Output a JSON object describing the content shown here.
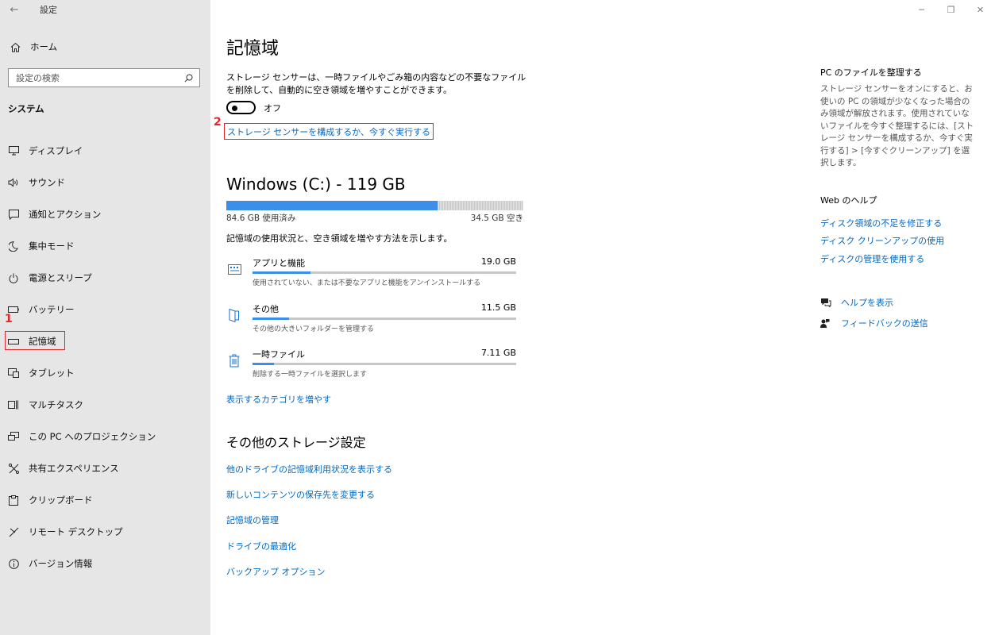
{
  "titlebar": {
    "back_icon": "back-arrow-icon",
    "title": "設定"
  },
  "window_controls": {
    "minimize": "─",
    "restore": "❐",
    "close": "✕"
  },
  "sidebar": {
    "home_label": "ホーム",
    "search_placeholder": "設定の検索",
    "section": "システム",
    "items": [
      {
        "label": "ディスプレイ",
        "icon": "display-icon"
      },
      {
        "label": "サウンド",
        "icon": "speaker-icon"
      },
      {
        "label": "通知とアクション",
        "icon": "notification-icon"
      },
      {
        "label": "集中モード",
        "icon": "moon-icon"
      },
      {
        "label": "電源とスリープ",
        "icon": "power-icon"
      },
      {
        "label": "バッテリー",
        "icon": "battery-icon"
      },
      {
        "label": "記憶域",
        "icon": "storage-icon",
        "selected": true
      },
      {
        "label": "タブレット",
        "icon": "tablet-icon"
      },
      {
        "label": "マルチタスク",
        "icon": "multitask-icon"
      },
      {
        "label": "この PC へのプロジェクション",
        "icon": "projection-icon"
      },
      {
        "label": "共有エクスペリエンス",
        "icon": "share-icon"
      },
      {
        "label": "クリップボード",
        "icon": "clipboard-icon"
      },
      {
        "label": "リモート デスクトップ",
        "icon": "remote-icon"
      },
      {
        "label": "バージョン情報",
        "icon": "info-icon"
      }
    ]
  },
  "annotations": {
    "step1": "1",
    "step2": "2"
  },
  "main": {
    "title": "記憶域",
    "description": "ストレージ センサーは、一時ファイルやごみ箱の内容などの不要なファイルを削除して、自動的に空き領域を増やすことができます。",
    "toggle_state": "オフ",
    "sense_link": "ストレージ センサーを構成するか、今すぐ実行する",
    "drive_title": "Windows (C:) - 119 GB",
    "used": "84.6 GB 使用済み",
    "free": "34.5 GB 空き",
    "used_fraction": 0.711,
    "categories_desc": "記憶域の使用状況と、空き領域を増やす方法を示します。",
    "categories": [
      {
        "name": "アプリと機能",
        "size": "19.0 GB",
        "sub": "使用されていない、または不要なアプリと機能をアンインストールする",
        "fraction": 0.22
      },
      {
        "name": "その他",
        "size": "11.5 GB",
        "sub": "その他の大きいフォルダーを管理する",
        "fraction": 0.14
      },
      {
        "name": "一時ファイル",
        "size": "7.11 GB",
        "sub": "削除する一時ファイルを選択します",
        "fraction": 0.08
      }
    ],
    "more_categories": "表示するカテゴリを増やす",
    "other_title": "その他のストレージ設定",
    "other_links": [
      "他のドライブの記憶域利用状況を表示する",
      "新しいコンテンツの保存先を変更する",
      "記憶域の管理",
      "ドライブの最適化",
      "バックアップ オプション"
    ]
  },
  "right": {
    "tidy_title": "PC のファイルを整理する",
    "tidy_desc": "ストレージ センサーをオンにすると、お使いの PC の領域が少なくなった場合のみ領域が解放されます。使用されていないファイルを今すぐ整理するには、[ストレージ センサーを構成するか、今すぐ実行する] > [今すぐクリーンアップ] を選択します。",
    "web_help_title": "Web のヘルプ",
    "web_links": [
      "ディスク領域の不足を修正する",
      "ディスク クリーンアップの使用",
      "ディスクの管理を使用する"
    ],
    "help_link": "ヘルプを表示",
    "feedback_link": "フィードバックの送信"
  }
}
